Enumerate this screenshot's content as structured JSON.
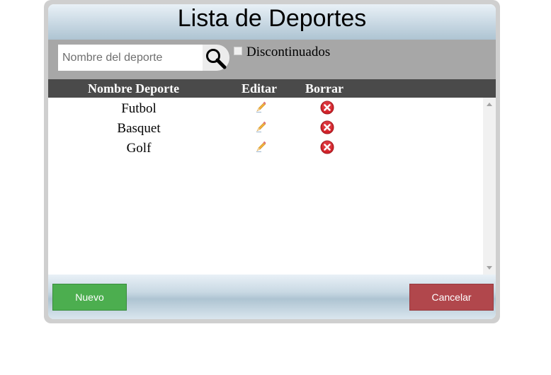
{
  "window": {
    "title": "Lista de Deportes"
  },
  "search": {
    "placeholder": "Nombre del deporte",
    "value": "",
    "icon": "magnifier-icon"
  },
  "filter": {
    "label": "Discontinuados",
    "checked": false
  },
  "table": {
    "headers": [
      "Nombre Deporte",
      "Editar",
      "Borrar"
    ],
    "rows": [
      {
        "name": "Futbol"
      },
      {
        "name": "Basquet"
      },
      {
        "name": "Golf"
      }
    ],
    "icons": {
      "edit": "pencil-icon",
      "delete": "red-x-circle-icon"
    }
  },
  "footer": {
    "new_label": "Nuevo",
    "cancel_label": "Cancelar"
  },
  "colors": {
    "new_button": "#4cae4f",
    "cancel_button": "#b1474c",
    "header_bg": "#4a4a4a",
    "search_bar_bg": "#a7a7a7"
  }
}
